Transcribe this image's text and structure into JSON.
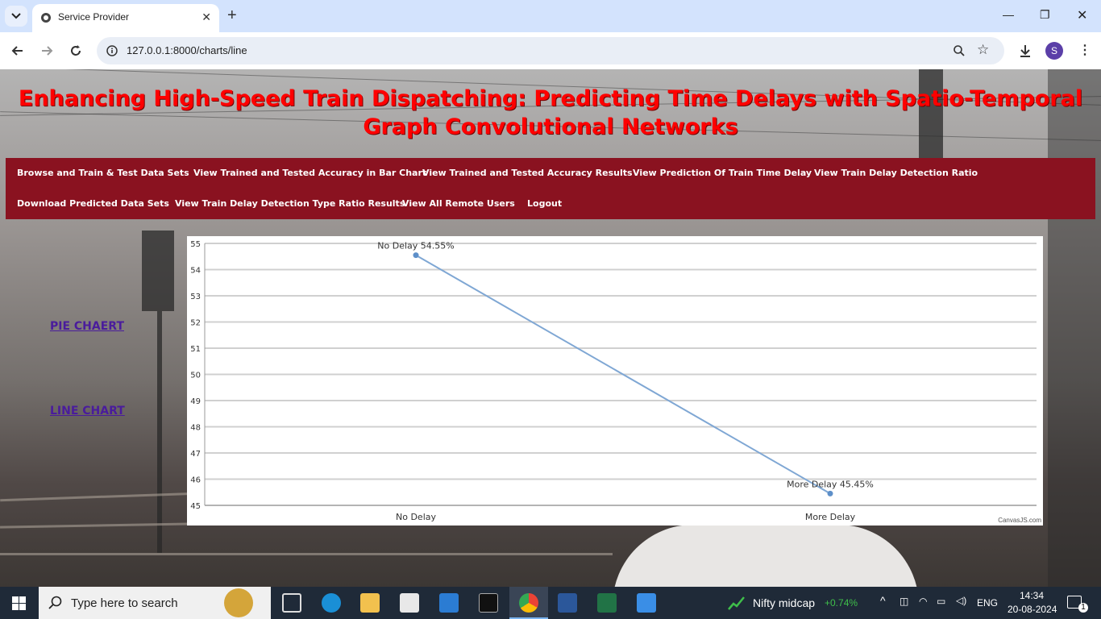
{
  "browser": {
    "tab_title": "Service Provider",
    "url": "127.0.0.1:8000/charts/line",
    "profile_initial": "S"
  },
  "page": {
    "title_line1": "Enhancing High-Speed Train Dispatching: Predicting Time Delays with Spatio-Temporal",
    "title_line2": "Graph Convolutional Networks",
    "nav": [
      {
        "label": "Browse and Train & Test Data Sets"
      },
      {
        "label": "View Trained and Tested Accuracy in Bar Chart"
      },
      {
        "label": "View Trained and Tested Accuracy Results"
      },
      {
        "label": "View Prediction Of Train Time Delay"
      },
      {
        "label": "View Train Delay Detection Ratio"
      },
      {
        "label": "Download Predicted Data Sets"
      },
      {
        "label": "View Train Delay Detection Type Ratio Results"
      },
      {
        "label": "View All Remote Users"
      },
      {
        "label": "Logout"
      }
    ],
    "side_links": {
      "pie": "PIE CHAERT",
      "line": "LINE CHART"
    },
    "chart_credit": "CanvasJS.com"
  },
  "chart_data": {
    "type": "line",
    "categories": [
      "No Delay",
      "More Delay"
    ],
    "values": [
      54.55,
      45.45
    ],
    "point_labels": [
      "No Delay 54.55%",
      "More Delay 45.45%"
    ],
    "ylim": [
      45,
      55
    ],
    "yticks": [
      45,
      46,
      47,
      48,
      49,
      50,
      51,
      52,
      53,
      54,
      55
    ],
    "grid": true,
    "line_color": "#7fa7d4"
  },
  "taskbar": {
    "search_placeholder": "Type here to search",
    "ticker_name": "Nifty midcap",
    "ticker_change": "+0.74%",
    "language": "ENG",
    "time": "14:34",
    "date": "20-08-2024",
    "notification_count": "1"
  }
}
